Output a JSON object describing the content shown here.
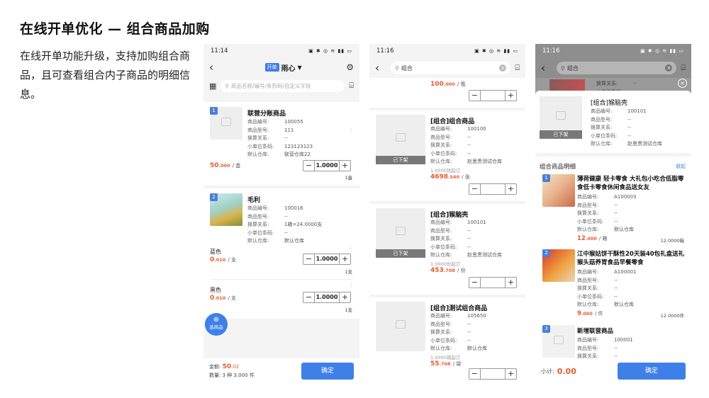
{
  "slide": {
    "title": "在线开单优化 — 组合商品加购",
    "description": "在线开单功能升级，支持加购组合商品，且可查看组合内子商品的明细信息。"
  },
  "colors": {
    "primary": "#3f7fe8",
    "price": "#e65a2e"
  },
  "labels": {
    "code": "商品编号:",
    "model": "商品型号:",
    "conv": "换算关系:",
    "barcode": "小单位条码:",
    "warehouse": "默认仓库:"
  },
  "phone1": {
    "time": "11:14",
    "status_icons": "▣ ✱ ◎ ≋ ▮▮ ▭",
    "tag": "开单",
    "store": "雨心",
    "search_placeholder": "商品名称/编号/条形码/自定义字段",
    "items": [
      {
        "index": "1",
        "name": "联营分账商品",
        "code": "100055",
        "model": "111",
        "conv": "--",
        "barcode": "123123123",
        "warehouse": "联营仓库22",
        "price_int": "50",
        "price_dec": ".000",
        "unit": "/ 盒",
        "qty": "1.0000",
        "minor": "1盒"
      },
      {
        "index": "2",
        "name": "毛利",
        "code": "100016",
        "model": "--",
        "conv": "1箱=24.0000支",
        "barcode": "--",
        "warehouse": "默认仓库"
      }
    ],
    "variants": [
      {
        "name": "蓝色",
        "price_int": "0",
        "price_dec": ".010",
        "unit": "/ 支",
        "qty": "1.0000",
        "minor": "1支"
      },
      {
        "name": "黑色",
        "price_int": "0",
        "price_dec": ".010",
        "unit": "/ 支",
        "qty": "1.0000",
        "minor": "1支"
      }
    ],
    "fab": "选商品",
    "amount_label": "金额:",
    "amount_int": "50",
    "amount_dec": ".02",
    "qty_summary": "数量: 3 种 3.000 件",
    "ok": "确定"
  },
  "phone2": {
    "time": "11:16",
    "status_icons": "▣ ✱ ◎ ≋ ▮▮ ▭",
    "search": "组合",
    "top_price": "100",
    "top_price_dec": ".000",
    "top_unit": "/ 瓶",
    "off": "已下架",
    "items": [
      {
        "name": "[组合]组合商品",
        "code": "100100",
        "model": "--",
        "conv": "--",
        "barcode": "--",
        "warehouse": "赵思贵测试仓库",
        "moq": "1.0000张起订",
        "price_int": "4698",
        "price_dec": ".540",
        "unit": "/ 张"
      },
      {
        "name": "[组合]猴脑壳",
        "code": "100101",
        "model": "--",
        "conv": "--",
        "barcode": "--",
        "warehouse": "赵思贵测试仓库",
        "moq": "1.0000份起订",
        "price_int": "453",
        "price_dec": ".708",
        "unit": "/ 份"
      },
      {
        "name": "[组合]测试组合商品",
        "code": "105650",
        "model": "--",
        "conv": "--",
        "barcode": "--",
        "warehouse": "默认仓库",
        "moq": "1.0000袋起订",
        "price_int": "55",
        "price_dec": ".708",
        "unit": "/ 袋"
      }
    ]
  },
  "phone3": {
    "time": "11:16",
    "status_icons": "▣ ✱ ◎ ≋ ▮▮ ▭",
    "search": "组合",
    "bg_text": "换算关系:",
    "bg_val": "--",
    "bg_text2": "小单位条码:",
    "head": {
      "name": "[组合]猴脑壳",
      "code": "100101",
      "model": "--",
      "conv": "--",
      "barcode": "--",
      "warehouse": "赵思贵测试仓库",
      "off": "已下架"
    },
    "detail_title": "组合商品明细",
    "collapse": "收起",
    "items": [
      {
        "index": "1",
        "name": "薄荷健康 轻卡零食 大礼包小吃合低脂零食低卡零食休闲食品送女友",
        "code": "A100003",
        "model": "--",
        "conv": "--",
        "barcode": "--",
        "warehouse": "默认仓库",
        "price_int": "12",
        "price_dec": ".000",
        "unit": "/ 箱",
        "qty": "12.0000箱"
      },
      {
        "index": "2",
        "name": "江中猴姑饼干酥性20天装40包礼盒送礼猴头菇养胃食品早餐零食",
        "code": "A100001",
        "model": "--",
        "conv": "--",
        "barcode": "--",
        "warehouse": "默认仓库",
        "price_int": "9",
        "price_dec": ".000",
        "unit": "/ 件",
        "qty": "12.0000件"
      },
      {
        "index": "3",
        "name": "新增联营商品",
        "code": "100001",
        "model": "--",
        "conv": "--"
      }
    ],
    "subtotal_label": "小计:",
    "subtotal": "0.00",
    "ok": "确定"
  }
}
